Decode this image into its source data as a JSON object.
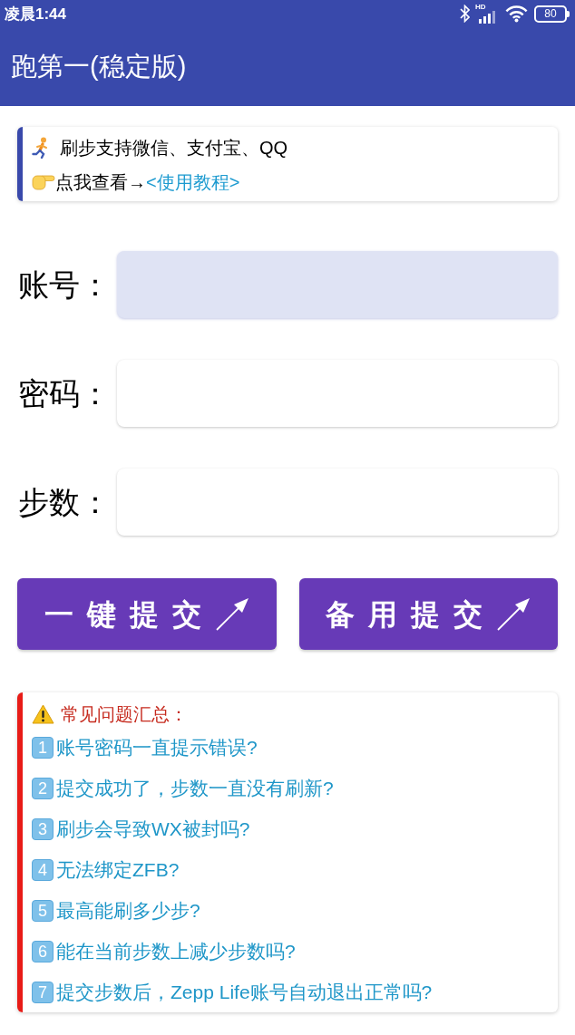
{
  "status_bar": {
    "time": "凌晨1:44",
    "network": "HD",
    "battery": "80"
  },
  "app_bar": {
    "title": "跑第一(稳定版)"
  },
  "notice": {
    "lines": [
      {
        "kind": "runner",
        "text": "刷步支持微信、支付宝、QQ"
      },
      {
        "kind": "pointer",
        "text": "点我查看→",
        "link": "<使用教程>"
      }
    ]
  },
  "form": {
    "fields": [
      {
        "label": "账号：",
        "focused": true
      },
      {
        "label": "密码：",
        "focused": false
      },
      {
        "label": "步数：",
        "focused": false
      }
    ]
  },
  "buttons": [
    {
      "label": "一键提交"
    },
    {
      "label": "备用提交"
    }
  ],
  "faq": {
    "title": "常见问题汇总：",
    "items": [
      {
        "number": "1",
        "text": "账号密码一直提示错误?"
      },
      {
        "number": "2",
        "text": "提交成功了，步数一直没有刷新?"
      },
      {
        "number": "3",
        "text": "刷步会导致WX被封吗?"
      },
      {
        "number": "4",
        "text": "无法绑定ZFB?"
      },
      {
        "number": "5",
        "text": "最高能刷多少步?"
      },
      {
        "number": "6",
        "text": "能在当前步数上减少步数吗?"
      },
      {
        "number": "7",
        "text": "提交步数后，Zepp Life账号自动退出正常吗?"
      }
    ]
  }
}
